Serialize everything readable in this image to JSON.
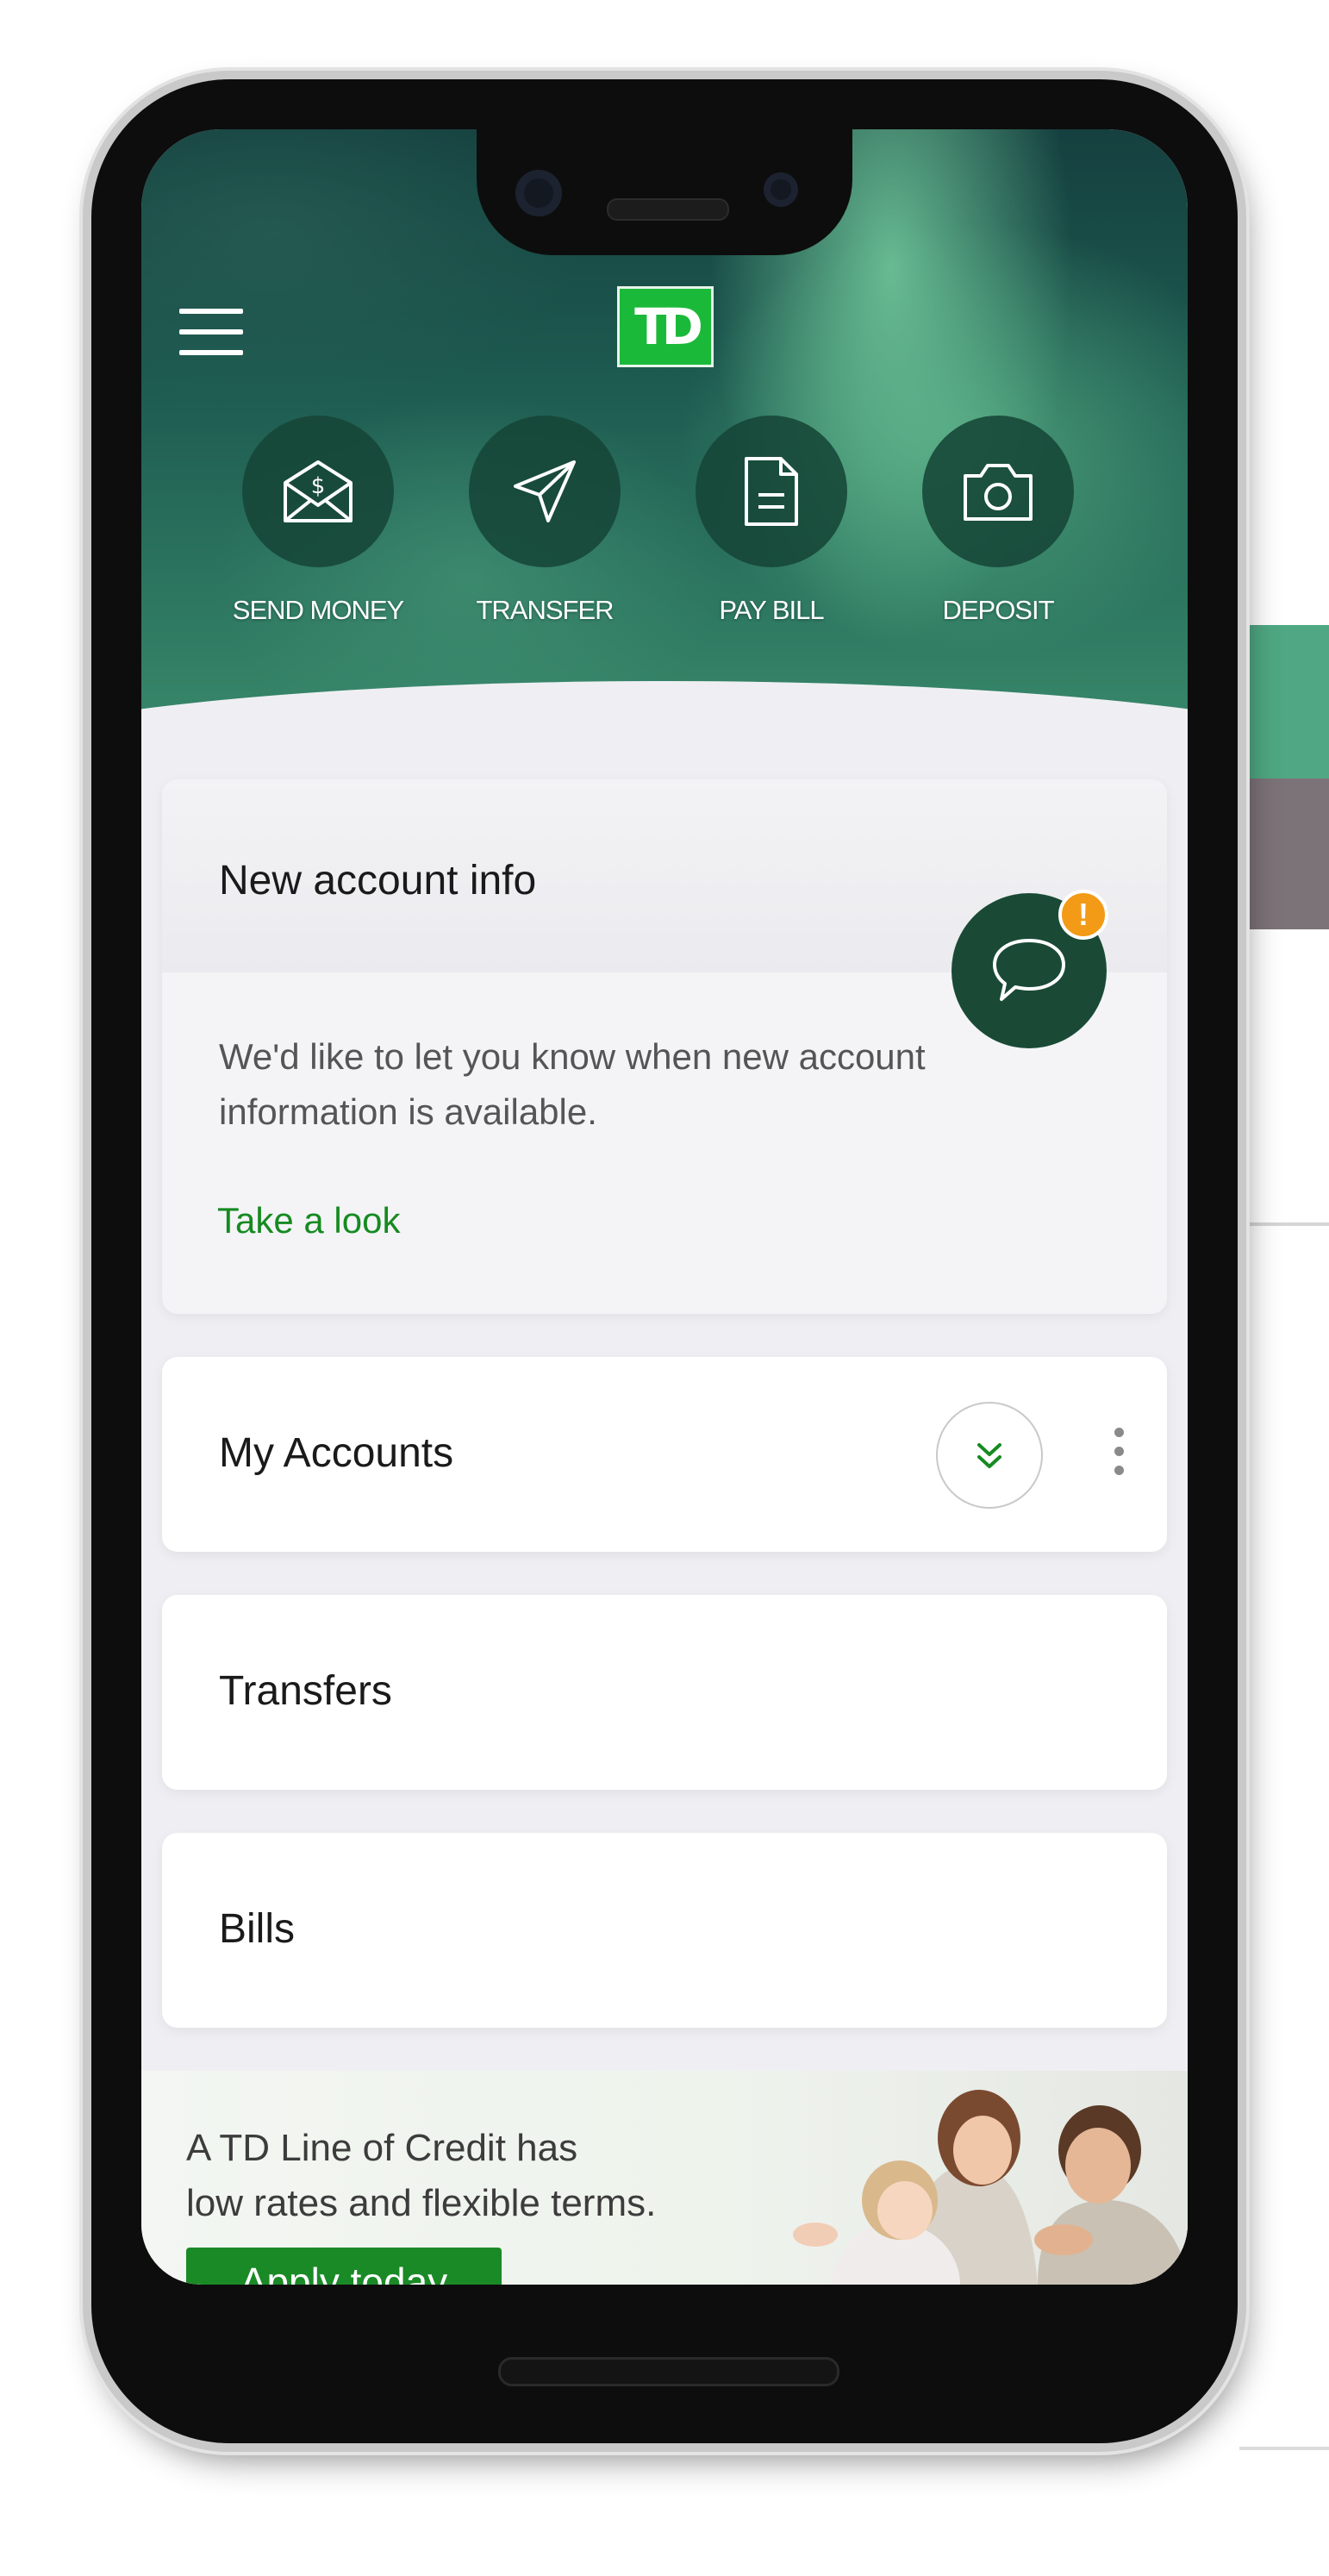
{
  "header": {
    "logo_text": "TD",
    "quick_actions": [
      {
        "label": "SEND MONEY",
        "icon": "envelope-dollar-icon"
      },
      {
        "label": "TRANSFER",
        "icon": "paper-plane-icon"
      },
      {
        "label": "PAY BILL",
        "icon": "document-icon"
      },
      {
        "label": "DEPOSIT",
        "icon": "camera-icon"
      }
    ]
  },
  "notification_card": {
    "title": "New account info",
    "body": "We'd like to let you know when new account information is available.",
    "link": "Take a look",
    "alert_badge": "!"
  },
  "sections": [
    {
      "title": "My Accounts"
    },
    {
      "title": "Transfers"
    },
    {
      "title": "Bills"
    }
  ],
  "promo": {
    "line1": "A TD Line of Credit has",
    "line2": "low rates and flexible terms.",
    "button": "Apply today"
  },
  "colors": {
    "brand_green": "#1bb93a",
    "link_green": "#168a21",
    "dark_green": "#1a4a36",
    "alert_orange": "#f39a16"
  }
}
